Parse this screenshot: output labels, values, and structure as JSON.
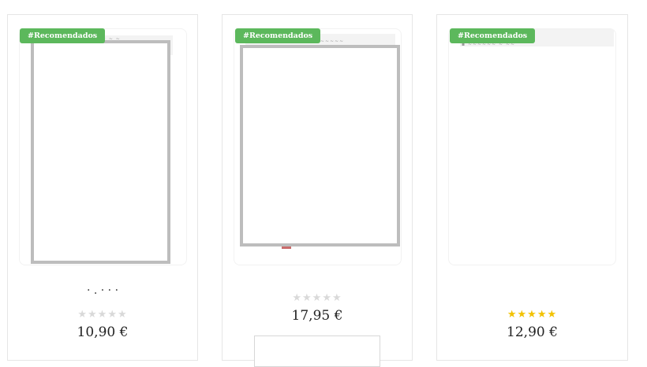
{
  "products": [
    {
      "badge": "#Recomendados",
      "title_fragment": "· . · · ·",
      "rating": 0,
      "rating_max": 5,
      "price": "10,90 €"
    },
    {
      "badge": "#Recomendados",
      "rating": 0,
      "rating_max": 5,
      "price": "17,95 €"
    },
    {
      "badge": "#Recomendados",
      "rating": 5,
      "rating_max": 5,
      "price": "12,90 €"
    }
  ],
  "colors": {
    "badge_bg": "#5cb85c",
    "star_full": "#f2c200",
    "star_empty": "#d9d9d9",
    "book_border": "#bdbdbd"
  }
}
